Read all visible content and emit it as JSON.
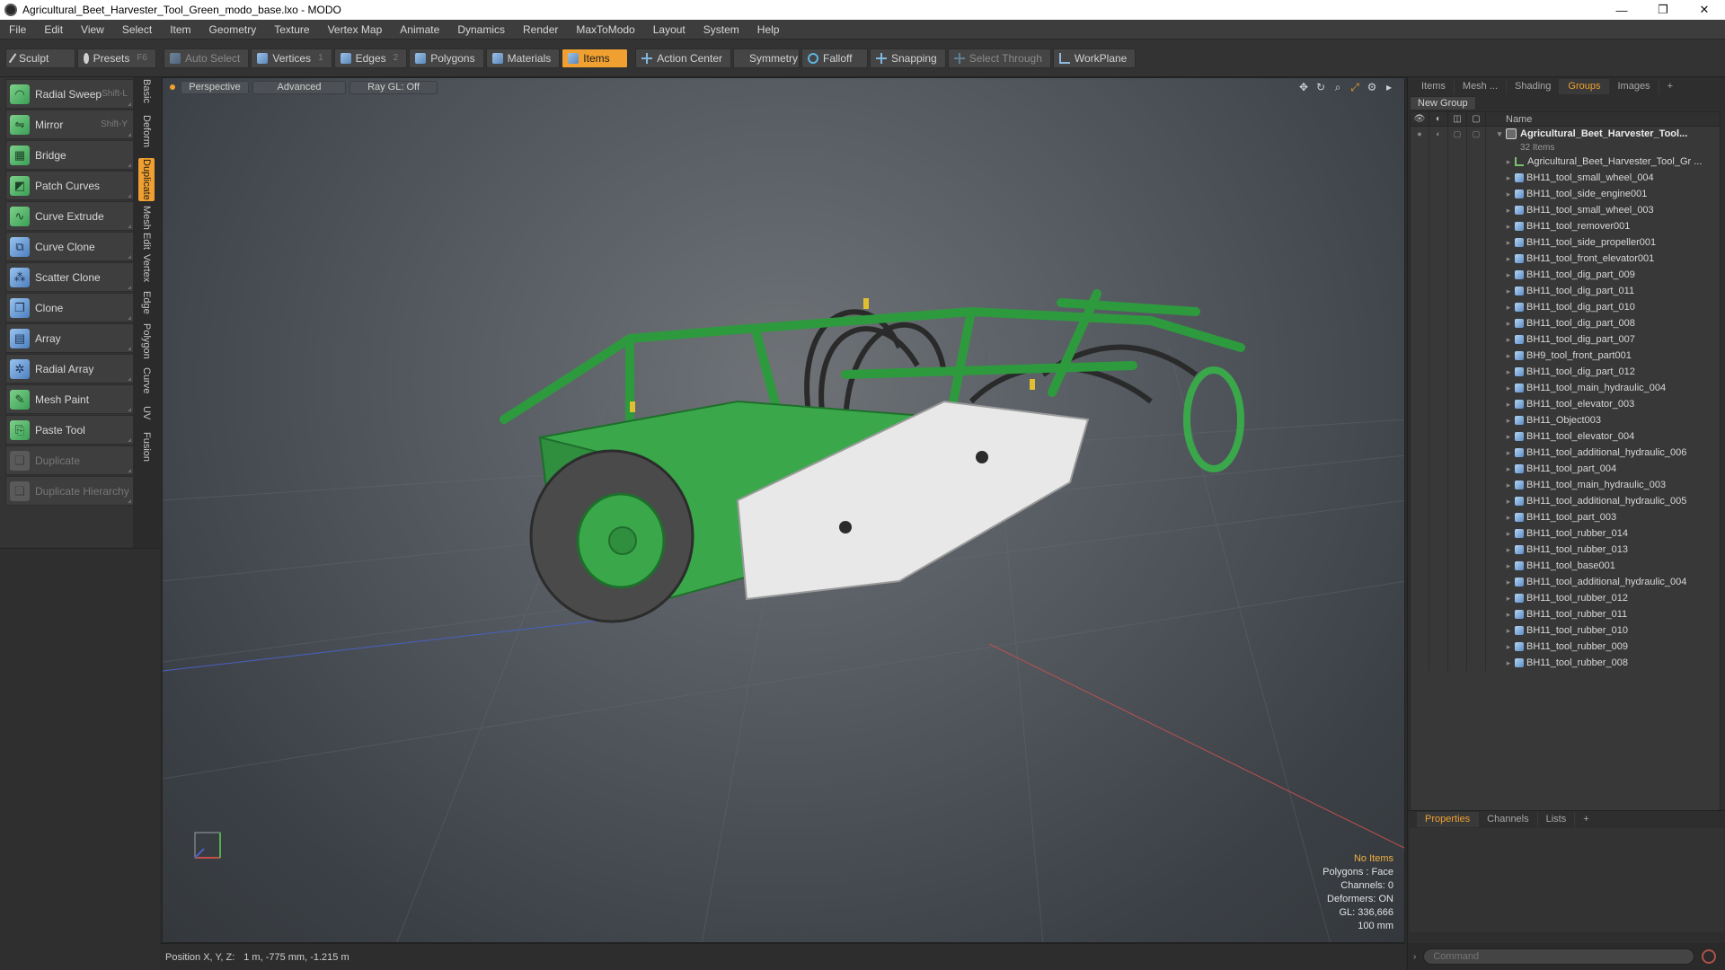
{
  "window": {
    "title": "Agricultural_Beet_Harvester_Tool_Green_modo_base.lxo - MODO",
    "minimize": "—",
    "restore": "❐",
    "close": "✕"
  },
  "menu": [
    "File",
    "Edit",
    "View",
    "Select",
    "Item",
    "Geometry",
    "Texture",
    "Vertex Map",
    "Animate",
    "Dynamics",
    "Render",
    "MaxToModo",
    "Layout",
    "System",
    "Help"
  ],
  "toolbar": {
    "sculpt": "Sculpt",
    "presets": "Presets",
    "presets_hint": "F6",
    "auto_select": "Auto Select",
    "vertices": "Vertices",
    "vertices_hint": "1",
    "edges": "Edges",
    "edges_hint": "2",
    "polygons": "Polygons",
    "materials": "Materials",
    "items": "Items",
    "action_center": "Action Center",
    "symmetry": "Symmetry",
    "falloff": "Falloff",
    "snapping": "Snapping",
    "select_through": "Select Through",
    "workplane": "WorkPlane"
  },
  "tools": [
    {
      "label": "Radial Sweep",
      "shortcut": "Shift-L",
      "icon": "radial-sweep-icon",
      "glyph": "◠",
      "enabled": true
    },
    {
      "label": "Mirror",
      "shortcut": "Shift-Y",
      "icon": "mirror-icon",
      "glyph": "⇋",
      "enabled": true
    },
    {
      "label": "Bridge",
      "shortcut": "",
      "icon": "bridge-icon",
      "glyph": "▦",
      "enabled": true
    },
    {
      "label": "Patch Curves",
      "shortcut": "",
      "icon": "patch-curves-icon",
      "glyph": "◩",
      "enabled": true
    },
    {
      "label": "Curve Extrude",
      "shortcut": "",
      "icon": "curve-extrude-icon",
      "glyph": "∿",
      "enabled": true
    },
    {
      "label": "Curve Clone",
      "shortcut": "",
      "icon": "curve-clone-icon",
      "glyph": "⧉",
      "enabled": true
    },
    {
      "label": "Scatter Clone",
      "shortcut": "",
      "icon": "scatter-clone-icon",
      "glyph": "⁂",
      "enabled": true
    },
    {
      "label": "Clone",
      "shortcut": "",
      "icon": "clone-icon",
      "glyph": "❐",
      "enabled": true
    },
    {
      "label": "Array",
      "shortcut": "",
      "icon": "array-icon",
      "glyph": "▤",
      "enabled": true
    },
    {
      "label": "Radial Array",
      "shortcut": "",
      "icon": "radial-array-icon",
      "glyph": "✲",
      "enabled": true
    },
    {
      "label": "Mesh Paint",
      "shortcut": "",
      "icon": "mesh-paint-icon",
      "glyph": "✎",
      "enabled": true
    },
    {
      "label": "Paste Tool",
      "shortcut": "",
      "icon": "paste-tool-icon",
      "glyph": "⎘",
      "enabled": true
    },
    {
      "label": "Duplicate",
      "shortcut": "",
      "icon": "duplicate-icon",
      "glyph": "❏",
      "enabled": false
    },
    {
      "label": "Duplicate Hierarchy",
      "shortcut": "",
      "icon": "duplicate-hierarchy-icon",
      "glyph": "❏",
      "enabled": false
    }
  ],
  "side_tabs": [
    {
      "label": "Basic",
      "active": false
    },
    {
      "label": "Deform",
      "active": false
    },
    {
      "label": "Duplicate",
      "active": true
    },
    {
      "label": "Mesh Edit",
      "active": false
    },
    {
      "label": "Vertex",
      "active": false
    },
    {
      "label": "Edge",
      "active": false
    },
    {
      "label": "Polygon",
      "active": false
    },
    {
      "label": "Curve",
      "active": false
    },
    {
      "label": "UV",
      "active": false
    },
    {
      "label": "Fusion",
      "active": false
    }
  ],
  "viewport": {
    "view_mode": "Perspective",
    "shading": "Advanced",
    "raygl": "Ray GL: Off",
    "info": {
      "selection": "No Items",
      "polygons": "Polygons : Face",
      "channels": "Channels: 0",
      "deformers": "Deformers: ON",
      "gl": "GL: 336,666",
      "scale": "100 mm"
    }
  },
  "status": {
    "label": "Position X, Y, Z:",
    "value": "1 m, -775 mm, -1.215 m"
  },
  "right_panel": {
    "tabs": [
      {
        "label": "Items",
        "active": false
      },
      {
        "label": "Mesh ...",
        "active": false
      },
      {
        "label": "Shading",
        "active": false
      },
      {
        "label": "Groups",
        "active": true
      },
      {
        "label": "Images",
        "active": false
      },
      {
        "label": "+",
        "active": false
      }
    ],
    "new_group": "New Group",
    "name_header": "Name",
    "root_name": "Agricultural_Beet_Harvester_Tool...",
    "root_count": "32 Items",
    "locator_name": "Agricultural_Beet_Harvester_Tool_Gr ...",
    "items": [
      "BH11_tool_small_wheel_004",
      "BH11_tool_side_engine001",
      "BH11_tool_small_wheel_003",
      "BH11_tool_remover001",
      "BH11_tool_side_propeller001",
      "BH11_tool_front_elevator001",
      "BH11_tool_dig_part_009",
      "BH11_tool_dig_part_011",
      "BH11_tool_dig_part_010",
      "BH11_tool_dig_part_008",
      "BH11_tool_dig_part_007",
      "BH9_tool_front_part001",
      "BH11_tool_dig_part_012",
      "BH11_tool_main_hydraulic_004",
      "BH11_tool_elevator_003",
      "BH11_Object003",
      "BH11_tool_elevator_004",
      "BH11_tool_additional_hydraulic_006",
      "BH11_tool_part_004",
      "BH11_tool_main_hydraulic_003",
      "BH11_tool_additional_hydraulic_005",
      "BH11_tool_part_003",
      "BH11_tool_rubber_014",
      "BH11_tool_rubber_013",
      "BH11_tool_base001",
      "BH11_tool_additional_hydraulic_004",
      "BH11_tool_rubber_012",
      "BH11_tool_rubber_011",
      "BH11_tool_rubber_010",
      "BH11_tool_rubber_009",
      "BH11_tool_rubber_008"
    ],
    "bottom_tabs": [
      {
        "label": "Properties",
        "active": true
      },
      {
        "label": "Channels",
        "active": false
      },
      {
        "label": "Lists",
        "active": false
      },
      {
        "label": "+",
        "active": false
      }
    ],
    "command_placeholder": "Command"
  },
  "colors": {
    "accent": "#f0a030",
    "model_green": "#3aa84a",
    "model_white": "#e8e8e8"
  }
}
